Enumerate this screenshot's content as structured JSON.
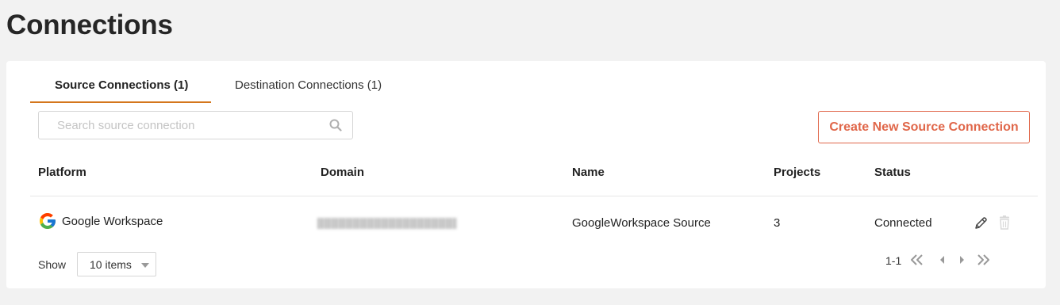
{
  "page": {
    "title": "Connections"
  },
  "tabs": [
    {
      "label": "Source Connections (1)",
      "active": true
    },
    {
      "label": "Destination Connections (1)",
      "active": false
    }
  ],
  "search": {
    "placeholder": "Search source connection",
    "value": ""
  },
  "actions": {
    "create_label": "Create New Source Connection"
  },
  "table": {
    "columns": [
      "Platform",
      "Domain",
      "Name",
      "Projects",
      "Status"
    ],
    "rows": [
      {
        "platform": "Google Workspace",
        "domain": "(blurred)",
        "name": "GoogleWorkspace Source",
        "projects": "3",
        "status": "Connected"
      }
    ]
  },
  "pagination": {
    "show_label": "Show",
    "page_size": "10 items",
    "range": "1-1"
  },
  "colors": {
    "accent": "#e0674a",
    "tab_underline": "#d4761c",
    "background": "#f2f2f2"
  },
  "icons": [
    "search-icon",
    "google-logo-icon",
    "edit-pencil-icon",
    "trash-icon",
    "caret-down-icon",
    "first-page-icon",
    "prev-page-icon",
    "next-page-icon",
    "last-page-icon"
  ]
}
